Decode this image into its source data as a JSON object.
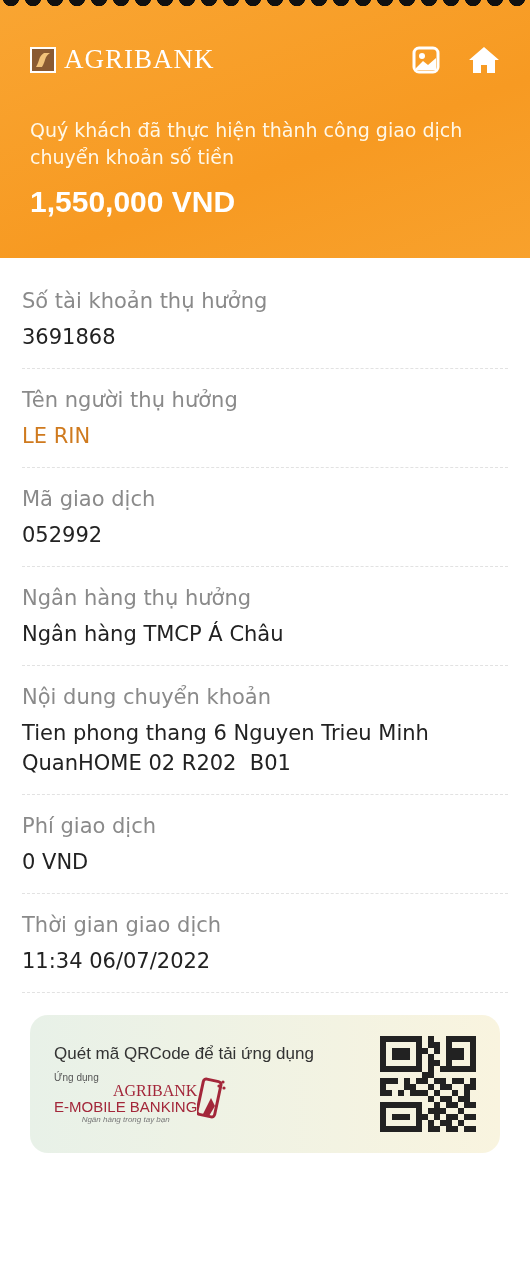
{
  "header": {
    "brand": "AGRIBANK",
    "message": "Quý khách đã thực hiện thành công giao dịch chuyển khoản số tiền",
    "amount": "1,550,000 VND"
  },
  "fields": [
    {
      "label": "Số tài khoản thụ hưởng",
      "value": "3691868",
      "kind": "plain"
    },
    {
      "label": "Tên người thụ hưởng",
      "value": "LE RIN",
      "kind": "accent"
    },
    {
      "label": "Mã giao dịch",
      "value": "052992",
      "kind": "plain"
    },
    {
      "label": "Ngân hàng thụ hưởng",
      "value": "Ngân hàng TMCP Á Châu",
      "kind": "plain"
    },
    {
      "label": "Nội dung chuyển khoản",
      "value": "Tien phong thang 6 Nguyen Trieu Minh QuanHOME 02 R202  B01",
      "kind": "plain"
    },
    {
      "label": "Phí giao dịch",
      "value": "0 VND",
      "kind": "plain"
    },
    {
      "label": "Thời gian giao dịch",
      "value": "11:34 06/07/2022",
      "kind": "plain"
    }
  ],
  "promo": {
    "title": "Quét mã QRCode để tải ứng dụng",
    "app_caption": "Ứng dụng",
    "app_brand": "AGRIBANK",
    "app_name": "E-MOBILE BANKING",
    "slogan": "Ngân hàng trong tay bạn"
  }
}
